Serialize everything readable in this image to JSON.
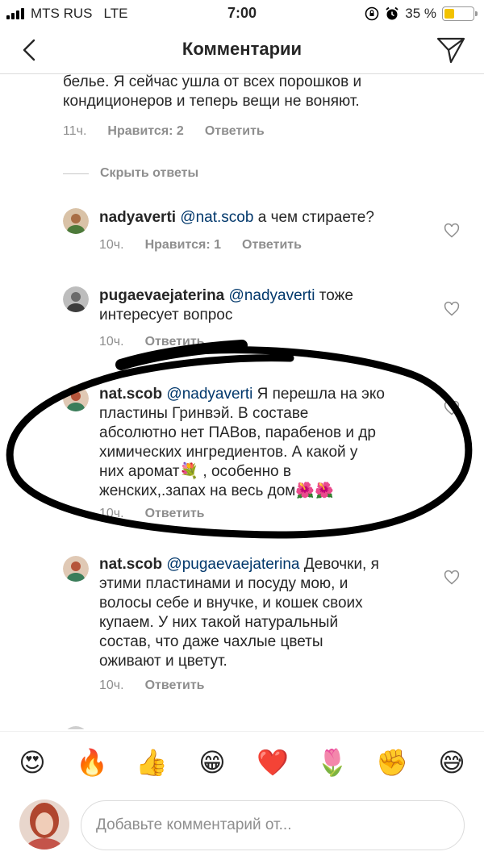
{
  "status_bar": {
    "carrier": "MTS RUS",
    "network": "LTE",
    "time": "7:00",
    "battery_text": "35 %",
    "battery_level": 0.35,
    "battery_color": "#f2c200"
  },
  "header": {
    "title": "Комментарии",
    "back_icon": "chevron-left-icon",
    "send_icon": "paper-plane-icon"
  },
  "parent_comment": {
    "text_line1": "белье. Я сейчас ушла от всех порошков и",
    "text_line2": "кондиционеров и теперь вещи не воняют.",
    "time": "11ч.",
    "likes": "Нравится: 2",
    "reply": "Ответить"
  },
  "hide_replies": "Скрыть ответы",
  "replies": [
    {
      "user": "nadyaverti",
      "mention": "@nat.scob",
      "text": " а чем стираете?",
      "time": "10ч.",
      "likes": "Нравится: 1",
      "reply": "Ответить"
    },
    {
      "user": "pugaevaejaterina",
      "mention": "@nadyaverti",
      "text_line1": " тоже",
      "text_line2": "интересует вопрос",
      "time": "10ч.",
      "reply": "Ответить"
    },
    {
      "user": "nat.scob",
      "mention": "@nadyaverti",
      "text_line1": " Я перешла на эко",
      "text_line2": "пластины Гринвэй. В составе",
      "text_line3": "абсолютно нет ПАВов, парабенов и др",
      "text_line4": "химических ингредиентов. А какой у",
      "text_line5": "них аромат💐 , особенно в",
      "text_line6": "женских,.запах на весь дом🌺🌺",
      "time": "10ч.",
      "reply": "Ответить"
    },
    {
      "user": "nat.scob",
      "mention": "@pugaevaejaterina",
      "text_line1": "  Девочки, я",
      "text_line2": "этими пластинами и посуду мою, и",
      "text_line3": "волосы себе и внучке, и кошек своих",
      "text_line4": "купаем. У них такой натуральный",
      "text_line5": "состав, что даже чахлые цветы",
      "text_line6": "оживают и цветут.",
      "time": "10ч.",
      "reply": "Ответить"
    }
  ],
  "emoji_bar": [
    "😍",
    "🔥",
    "👍",
    "😁",
    "❤️",
    "🌷",
    "✊",
    "😅"
  ],
  "composer": {
    "placeholder": "Добавьте комментарий от..."
  }
}
